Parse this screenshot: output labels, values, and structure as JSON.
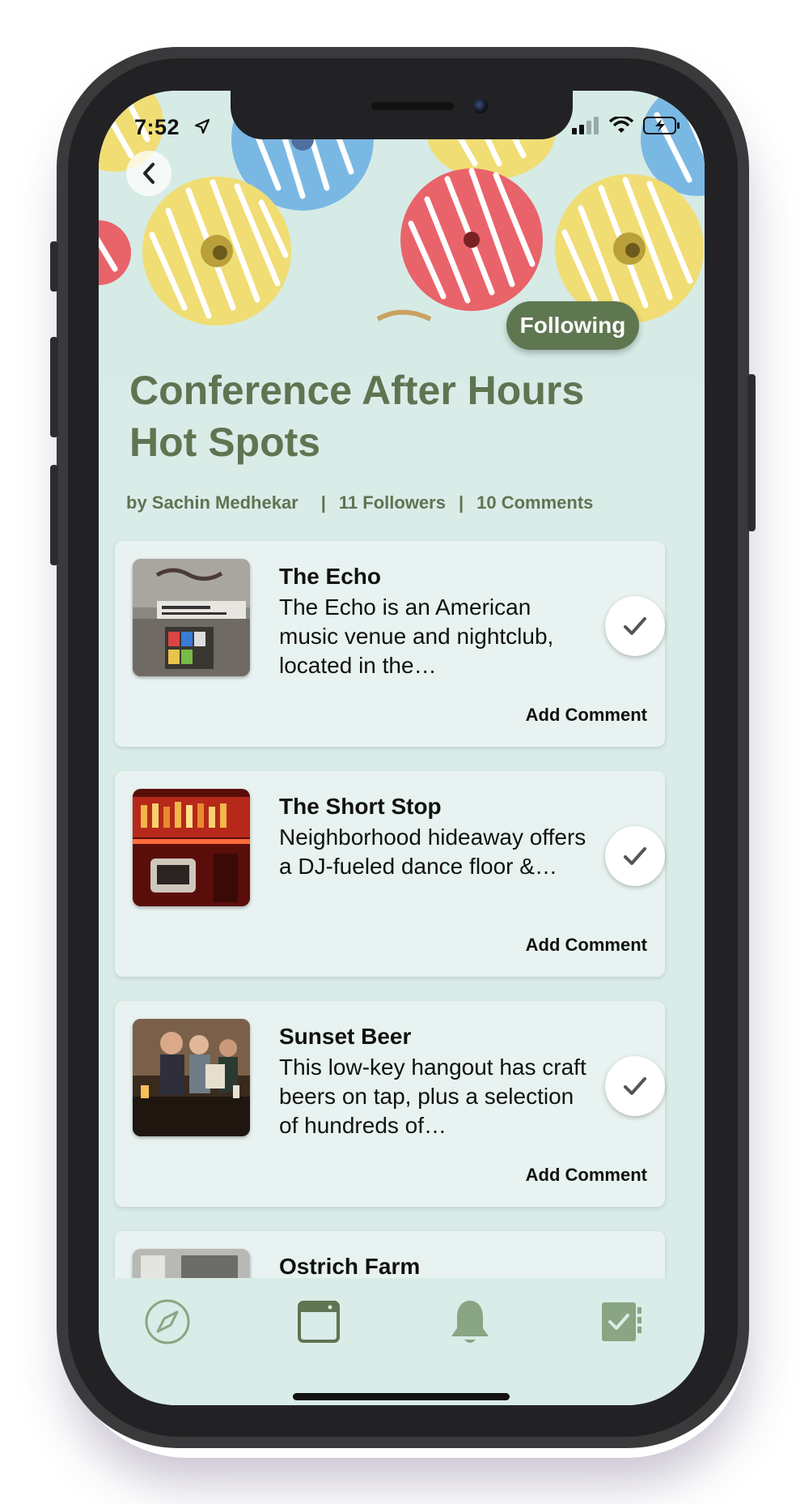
{
  "status_bar": {
    "time": "7:52"
  },
  "header": {
    "following_label": "Following",
    "title": "Conference After Hours Hot Spots",
    "author": "by Sachin Medhekar",
    "separator": "|",
    "followers": "11 Followers",
    "comments": "10 Comments"
  },
  "places": [
    {
      "name": "The Echo",
      "description": "The Echo is an American music venue and nightclub, located in the…",
      "action": "Add Comment"
    },
    {
      "name": "The Short Stop",
      "description": "Neighborhood hideaway offers a DJ-fueled dance floor &…",
      "action": "Add Comment"
    },
    {
      "name": "Sunset Beer",
      "description": "This low-key hangout has craft beers on tap, plus a selection of hundreds of…",
      "action": "Add Comment"
    },
    {
      "name": "Ostrich Farm",
      "description": "",
      "action": ""
    }
  ],
  "tabbar": {
    "icons": [
      "compass-icon",
      "browser-window-icon",
      "bell-icon",
      "checklist-icon"
    ]
  },
  "colors": {
    "accent": "#5f7451",
    "background": "#d9ece8",
    "card": "#e8f3f1",
    "following_button": "#5e7750"
  }
}
